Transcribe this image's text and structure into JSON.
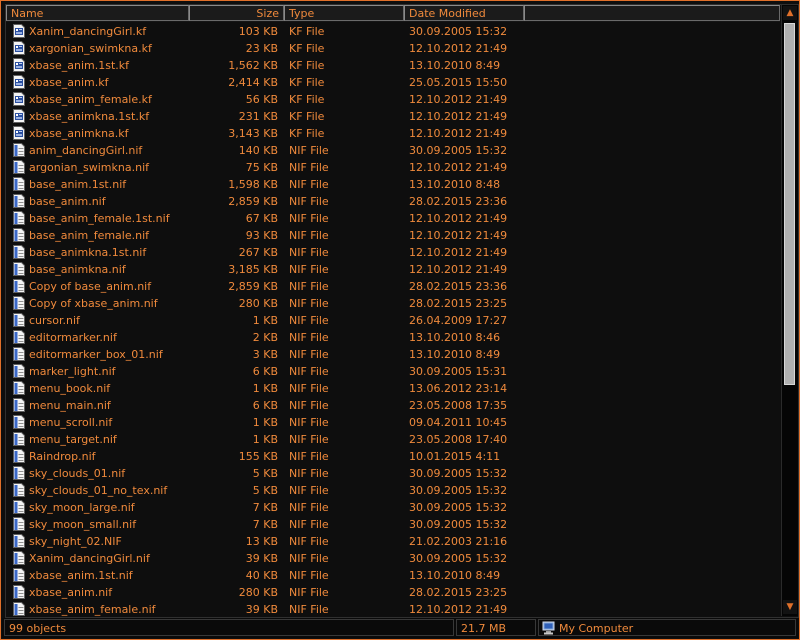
{
  "columns": {
    "name": "Name",
    "size": "Size",
    "type": "Type",
    "date": "Date Modified"
  },
  "files": [
    {
      "name": "Xanim_dancingGirl.kf",
      "size": "103 KB",
      "type": "KF File",
      "date": "30.09.2005 15:32",
      "icon": "kf-file-icon"
    },
    {
      "name": "xargonian_swimkna.kf",
      "size": "23 KB",
      "type": "KF File",
      "date": "12.10.2012 21:49",
      "icon": "kf-file-icon"
    },
    {
      "name": "xbase_anim.1st.kf",
      "size": "1,562 KB",
      "type": "KF File",
      "date": "13.10.2010 8:49",
      "icon": "kf-file-icon"
    },
    {
      "name": "xbase_anim.kf",
      "size": "2,414 KB",
      "type": "KF File",
      "date": "25.05.2015 15:50",
      "icon": "kf-file-icon"
    },
    {
      "name": "xbase_anim_female.kf",
      "size": "56 KB",
      "type": "KF File",
      "date": "12.10.2012 21:49",
      "icon": "kf-file-icon"
    },
    {
      "name": "xbase_animkna.1st.kf",
      "size": "231 KB",
      "type": "KF File",
      "date": "12.10.2012 21:49",
      "icon": "kf-file-icon"
    },
    {
      "name": "xbase_animkna.kf",
      "size": "3,143 KB",
      "type": "KF File",
      "date": "12.10.2012 21:49",
      "icon": "kf-file-icon"
    },
    {
      "name": "anim_dancingGirl.nif",
      "size": "140 KB",
      "type": "NIF File",
      "date": "30.09.2005 15:32",
      "icon": "nif-file-icon"
    },
    {
      "name": "argonian_swimkna.nif",
      "size": "75 KB",
      "type": "NIF File",
      "date": "12.10.2012 21:49",
      "icon": "nif-file-icon"
    },
    {
      "name": "base_anim.1st.nif",
      "size": "1,598 KB",
      "type": "NIF File",
      "date": "13.10.2010 8:48",
      "icon": "nif-file-icon"
    },
    {
      "name": "base_anim.nif",
      "size": "2,859 KB",
      "type": "NIF File",
      "date": "28.02.2015 23:36",
      "icon": "nif-file-icon"
    },
    {
      "name": "base_anim_female.1st.nif",
      "size": "67 KB",
      "type": "NIF File",
      "date": "12.10.2012 21:49",
      "icon": "nif-file-icon"
    },
    {
      "name": "base_anim_female.nif",
      "size": "93 KB",
      "type": "NIF File",
      "date": "12.10.2012 21:49",
      "icon": "nif-file-icon"
    },
    {
      "name": "base_animkna.1st.nif",
      "size": "267 KB",
      "type": "NIF File",
      "date": "12.10.2012 21:49",
      "icon": "nif-file-icon"
    },
    {
      "name": "base_animkna.nif",
      "size": "3,185 KB",
      "type": "NIF File",
      "date": "12.10.2012 21:49",
      "icon": "nif-file-icon"
    },
    {
      "name": "Copy of base_anim.nif",
      "size": "2,859 KB",
      "type": "NIF File",
      "date": "28.02.2015 23:36",
      "icon": "nif-file-icon"
    },
    {
      "name": "Copy of xbase_anim.nif",
      "size": "280 KB",
      "type": "NIF File",
      "date": "28.02.2015 23:25",
      "icon": "nif-file-icon"
    },
    {
      "name": "cursor.nif",
      "size": "1 KB",
      "type": "NIF File",
      "date": "26.04.2009 17:27",
      "icon": "nif-file-icon"
    },
    {
      "name": "editormarker.nif",
      "size": "2 KB",
      "type": "NIF File",
      "date": "13.10.2010 8:46",
      "icon": "nif-file-icon"
    },
    {
      "name": "editormarker_box_01.nif",
      "size": "3 KB",
      "type": "NIF File",
      "date": "13.10.2010 8:49",
      "icon": "nif-file-icon"
    },
    {
      "name": "marker_light.nif",
      "size": "6 KB",
      "type": "NIF File",
      "date": "30.09.2005 15:31",
      "icon": "nif-file-icon"
    },
    {
      "name": "menu_book.nif",
      "size": "1 KB",
      "type": "NIF File",
      "date": "13.06.2012 23:14",
      "icon": "nif-file-icon"
    },
    {
      "name": "menu_main.nif",
      "size": "6 KB",
      "type": "NIF File",
      "date": "23.05.2008 17:35",
      "icon": "nif-file-icon"
    },
    {
      "name": "menu_scroll.nif",
      "size": "1 KB",
      "type": "NIF File",
      "date": "09.04.2011 10:45",
      "icon": "nif-file-icon"
    },
    {
      "name": "menu_target.nif",
      "size": "1 KB",
      "type": "NIF File",
      "date": "23.05.2008 17:40",
      "icon": "nif-file-icon"
    },
    {
      "name": "Raindrop.nif",
      "size": "155 KB",
      "type": "NIF File",
      "date": "10.01.2015 4:11",
      "icon": "nif-file-icon"
    },
    {
      "name": "sky_clouds_01.nif",
      "size": "5 KB",
      "type": "NIF File",
      "date": "30.09.2005 15:32",
      "icon": "nif-file-icon"
    },
    {
      "name": "sky_clouds_01_no_tex.nif",
      "size": "5 KB",
      "type": "NIF File",
      "date": "30.09.2005 15:32",
      "icon": "nif-file-icon"
    },
    {
      "name": "sky_moon_large.nif",
      "size": "7 KB",
      "type": "NIF File",
      "date": "30.09.2005 15:32",
      "icon": "nif-file-icon"
    },
    {
      "name": "sky_moon_small.nif",
      "size": "7 KB",
      "type": "NIF File",
      "date": "30.09.2005 15:32",
      "icon": "nif-file-icon"
    },
    {
      "name": "sky_night_02.NIF",
      "size": "13 KB",
      "type": "NIF File",
      "date": "21.02.2003 21:16",
      "icon": "nif-file-icon"
    },
    {
      "name": "Xanim_dancingGirl.nif",
      "size": "39 KB",
      "type": "NIF File",
      "date": "30.09.2005 15:32",
      "icon": "nif-file-icon"
    },
    {
      "name": "xbase_anim.1st.nif",
      "size": "40 KB",
      "type": "NIF File",
      "date": "13.10.2010 8:49",
      "icon": "nif-file-icon"
    },
    {
      "name": "xbase_anim.nif",
      "size": "280 KB",
      "type": "NIF File",
      "date": "28.02.2015 23:25",
      "icon": "nif-file-icon"
    },
    {
      "name": "xbase_anim_female.nif",
      "size": "39 KB",
      "type": "NIF File",
      "date": "12.10.2012 21:49",
      "icon": "nif-file-icon"
    }
  ],
  "status": {
    "object_count": "99 objects",
    "total_size": "21.7 MB",
    "location": "My Computer"
  },
  "icons": {
    "scroll_up": "scroll-up-arrow-icon",
    "scroll_down": "scroll-down-arrow-icon",
    "location": "computer-icon"
  },
  "colors": {
    "accent": "#f08a3c",
    "border": "#e0702a",
    "background": "#0e0e0e"
  }
}
